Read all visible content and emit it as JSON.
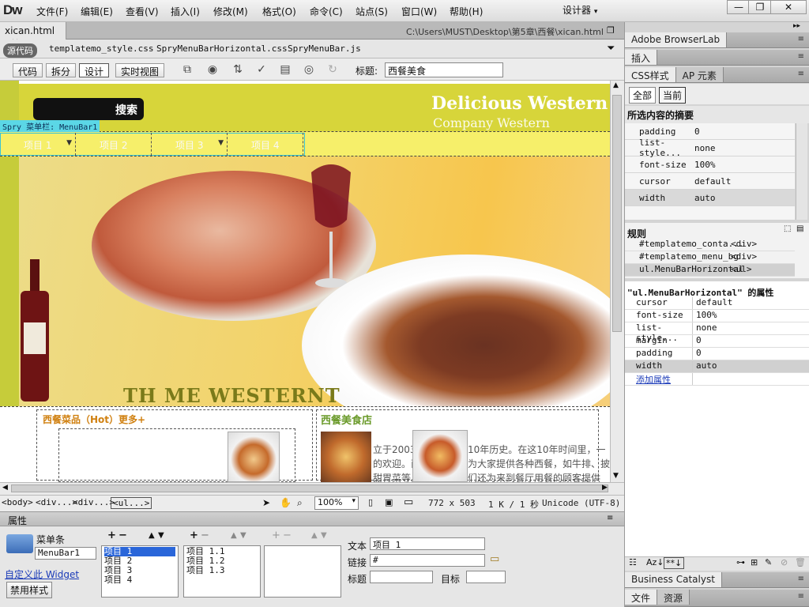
{
  "app": {
    "logo": "Dw",
    "menu": [
      "文件(F)",
      "编辑(E)",
      "查看(V)",
      "插入(I)",
      "修改(M)",
      "格式(O)",
      "命令(C)",
      "站点(S)",
      "窗口(W)",
      "帮助(H)"
    ],
    "workspace": "设计器",
    "window_buttons": [
      "—",
      "❐",
      "✕"
    ]
  },
  "document": {
    "tab_name": "xican.html",
    "tab_close": "×",
    "path": "C:\\Users\\MUST\\Desktop\\第5章\\西餐\\xican.html",
    "source_badge": "源代码",
    "related_files": [
      "templatemo_style.css",
      "SpryMenuBarHorizontal.css",
      "SpryMenuBar.js"
    ]
  },
  "toolbar": {
    "views": [
      "代码",
      "拆分",
      "设计",
      "实时视图"
    ],
    "active_view": "设计",
    "title_label": "标题:",
    "title_value": "西餐美食"
  },
  "page": {
    "search_button": "搜索",
    "brand_line1": "Delicious  Western",
    "brand_line2": "Company Western",
    "spry_tag": "Spry 菜单栏: MenuBar1",
    "nav_items": [
      "项目 1",
      "项目 2",
      "项目 3",
      "项目 4"
    ],
    "banner_text": "TH ME WESTERNT",
    "box1_title": "西餐菜品（Hot）更多+",
    "box2_title": "西餐美食店",
    "box2_text_line1": "立于2003",
    "box2_text_line1b": "10年历史。在这10年时间里，一",
    "box2_text_line2": "的欢迎。西",
    "box2_text_line2b": "为大家提供各种西餐，如牛排、披",
    "box2_text_line3": "甜胃菜等。",
    "box2_text_line3b": "们还为来到餐厅用餐的顾客提供"
  },
  "status": {
    "tags": [
      "<body>",
      "<div...>",
      "<div...>",
      "<ul...>"
    ],
    "zoom": "100%",
    "size": "772 x 503",
    "download": "1 K / 1 秒",
    "encoding": "Unicode (UTF-8)"
  },
  "properties": {
    "title": "属性",
    "widget_label": "菜单条",
    "widget_name": "MenuBar1",
    "customize_link": "自定义此 Widget",
    "disable_styles": "禁用样式",
    "list1": [
      "项目 1",
      "项目 2",
      "项目 3",
      "项目 4"
    ],
    "list2": [
      "项目 1.1",
      "项目 1.2",
      "项目 1.3"
    ],
    "text_label": "文本",
    "text_value": "项目 1",
    "link_label": "链接",
    "link_value": "#",
    "title_label": "标题",
    "target_label": "目标"
  },
  "right_panel": {
    "browserlab": "Adobe BrowserLab",
    "insert": "插入",
    "css_tab": "CSS样式",
    "ap_tab": "AP 元素",
    "all_btn": "全部",
    "current_btn": "当前",
    "summary_title": "所选内容的摘要",
    "summary": [
      {
        "k": "padding",
        "v": "0"
      },
      {
        "k": "list-style...",
        "v": "none"
      },
      {
        "k": "font-size",
        "v": "100%"
      },
      {
        "k": "cursor",
        "v": "default"
      },
      {
        "k": "width",
        "v": "auto"
      }
    ],
    "rules_title": "规则",
    "rules": [
      {
        "k": "#templatemo_conta...",
        "v": "<div>"
      },
      {
        "k": "#templatemo_menu_bg",
        "v": "<div>"
      },
      {
        "k": "ul.MenuBarHorizontal",
        "v": "<ul>"
      }
    ],
    "props_title": "\"ul.MenuBarHorizontal\" 的属性",
    "props": [
      {
        "k": "cursor",
        "v": "default"
      },
      {
        "k": "font-size",
        "v": "100%"
      },
      {
        "k": "list-style...",
        "v": "none"
      },
      {
        "k": "margin",
        "v": "0"
      },
      {
        "k": "padding",
        "v": "0"
      },
      {
        "k": "width",
        "v": "auto"
      }
    ],
    "add_prop": "添加属性",
    "business_catalyst": "Business Catalyst",
    "files_tab": "文件",
    "assets_tab": "资源"
  }
}
